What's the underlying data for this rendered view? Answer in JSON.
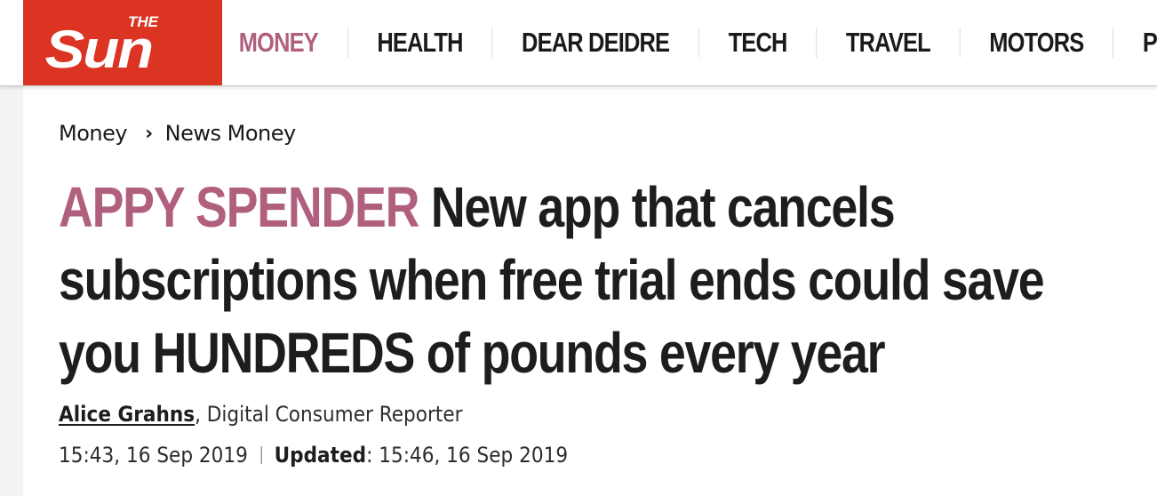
{
  "header": {
    "logo": {
      "small": "THE",
      "main": "Sun",
      "bg_color": "#dc3422"
    },
    "nav_items": [
      {
        "label": "MONEY",
        "visible_fragment": "Y",
        "active": true
      },
      {
        "label": "HEALTH"
      },
      {
        "label": "DEAR DEIDRE"
      },
      {
        "label": "TECH"
      },
      {
        "label": "TRAVEL"
      },
      {
        "label": "MOTORS"
      },
      {
        "label": "PUZZLES"
      }
    ]
  },
  "breadcrumb": {
    "items": [
      "Money",
      "News Money"
    ],
    "separator_icon": "chevron-right-icon"
  },
  "article": {
    "kicker": "APPY SPENDER",
    "headline": "New app that cancels subscriptions when free trial ends could save you HUNDREDS of pounds every year",
    "kicker_color": "#b0607e",
    "author": "Alice Grahns",
    "author_role": ", Digital Consumer Reporter",
    "published": "15:43, 16 Sep 2019",
    "updated_label": "Updated",
    "updated": ": 15:46, 16 Sep 2019"
  }
}
